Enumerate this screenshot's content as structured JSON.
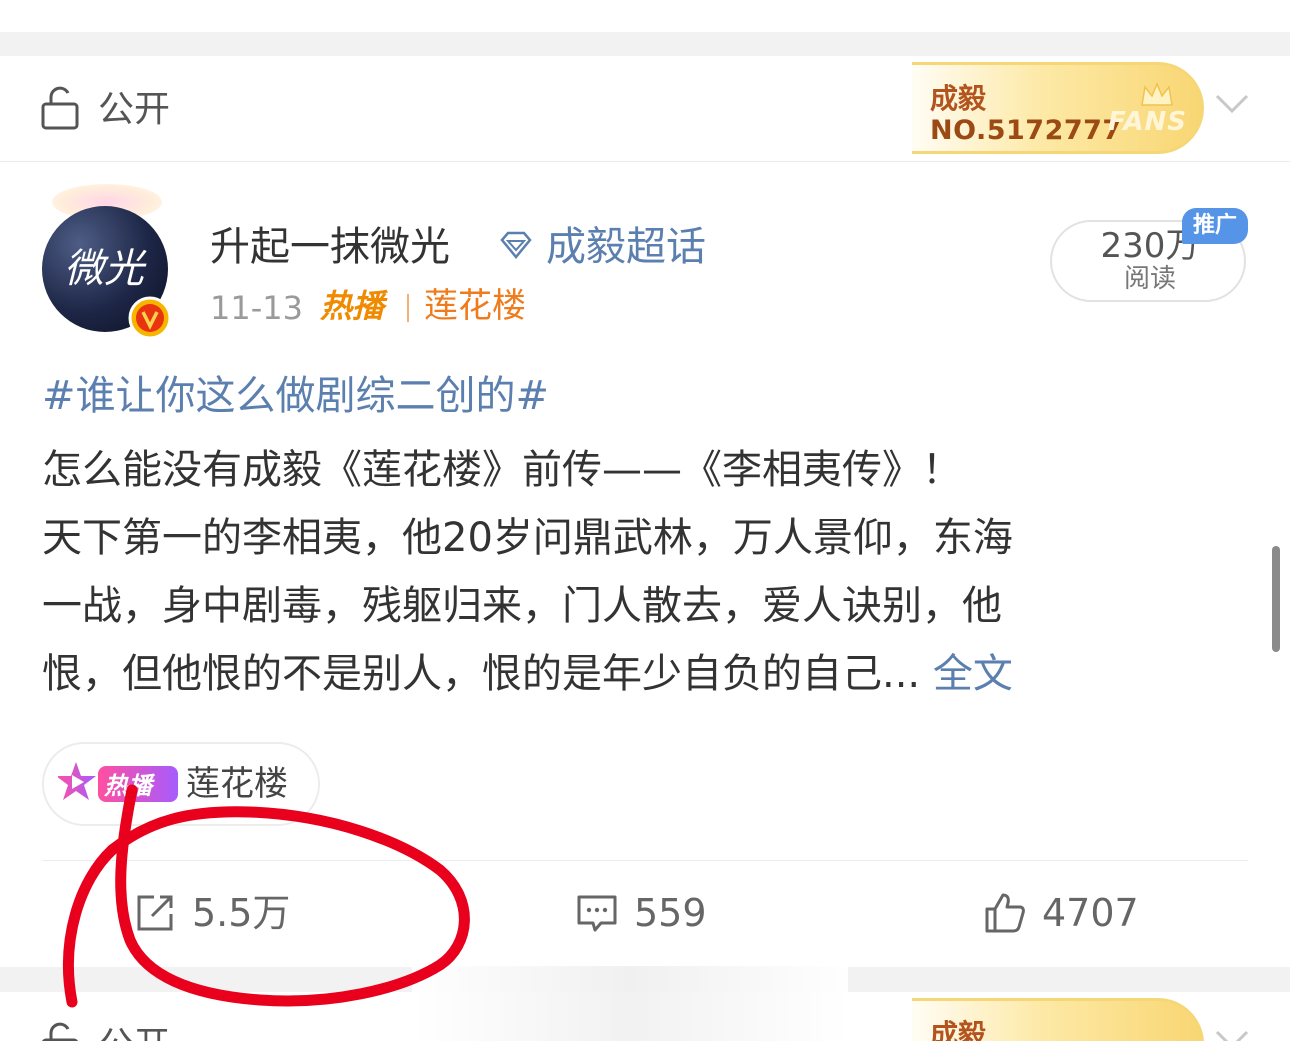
{
  "visibility": {
    "label": "公开",
    "icon": "lock-icon"
  },
  "fans_badge": {
    "name": "成毅",
    "number": "NO.5172777",
    "fans_text": "FANS"
  },
  "post": {
    "username": "升起一抹微光",
    "topic": "成毅超话",
    "date": "11-13",
    "hot_tag": "热播",
    "hot_show": "莲花楼",
    "reads": {
      "count": "230万",
      "label": "阅读"
    },
    "promo_badge": "推广",
    "hashtag": "#谁让你这么做剧综二创的#",
    "lines": [
      "怎么能没有成毅《莲花楼》前传——《李相夷传》！",
      "天下第一的李相夷，他20岁问鼎武林，万人景仰，东海",
      "一战，身中剧毒，残躯归来，门人散去，爱人诀别，他",
      "恨，但他恨的不是别人，恨的是年少自负的自己... "
    ],
    "full_text_link": "全文",
    "chip": {
      "badge": "热播",
      "label": "莲花楼"
    }
  },
  "actions": {
    "repost": "5.5万",
    "comment": "559",
    "like": "4707"
  },
  "next_card": {
    "visibility": "公开",
    "badge_name": "成毅"
  },
  "colors": {
    "link": "#5b7fae",
    "hot": "#f08a00",
    "badge_gold": "#f8d673",
    "annotation_red": "#e8001c"
  }
}
